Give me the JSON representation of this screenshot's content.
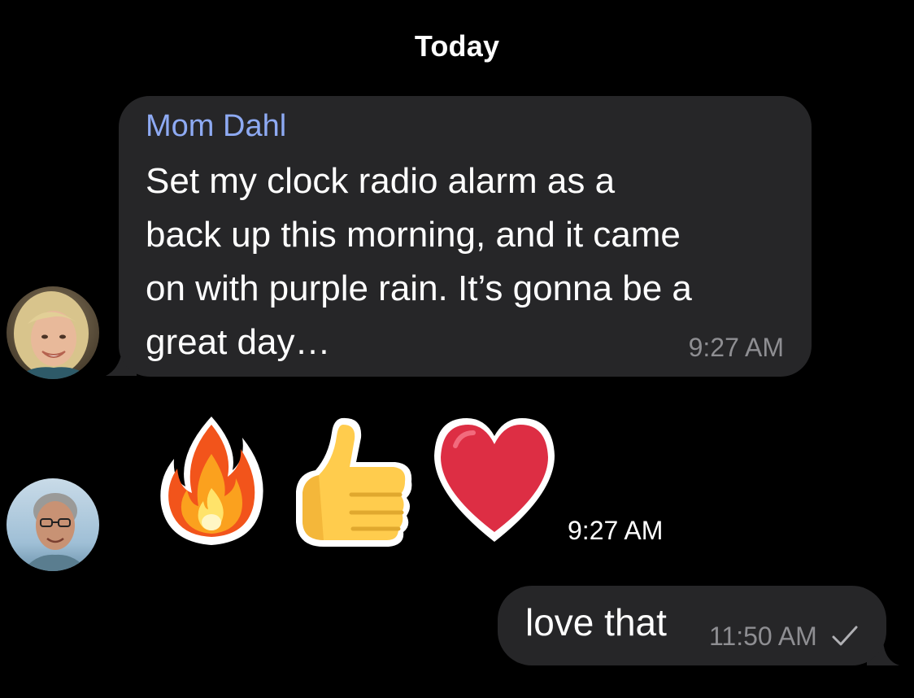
{
  "thread": {
    "date_header": "Today"
  },
  "messages": {
    "incoming": {
      "sender": "Mom Dahl",
      "text": "Set my clock radio alarm as a\nback up this morning, and it came\non with purple rain. It’s gonna be a\ngreat day…",
      "time": "9:27 AM",
      "avatar_icon": "avatar-photo-woman"
    },
    "reactions": {
      "emojis": [
        "fire-emoji",
        "thumbs-up-emoji",
        "red-heart-emoji"
      ],
      "time": "9:27 AM",
      "avatar_icon": "avatar-photo-man"
    },
    "outgoing": {
      "text": "love that",
      "time": "11:50 AM",
      "status_icon": "checkmark-icon"
    }
  },
  "colors": {
    "background": "#000000",
    "bubble": "#262628",
    "sender_name": "#8eaaf3",
    "timestamp": "#8e8e92",
    "text": "#ffffff"
  }
}
